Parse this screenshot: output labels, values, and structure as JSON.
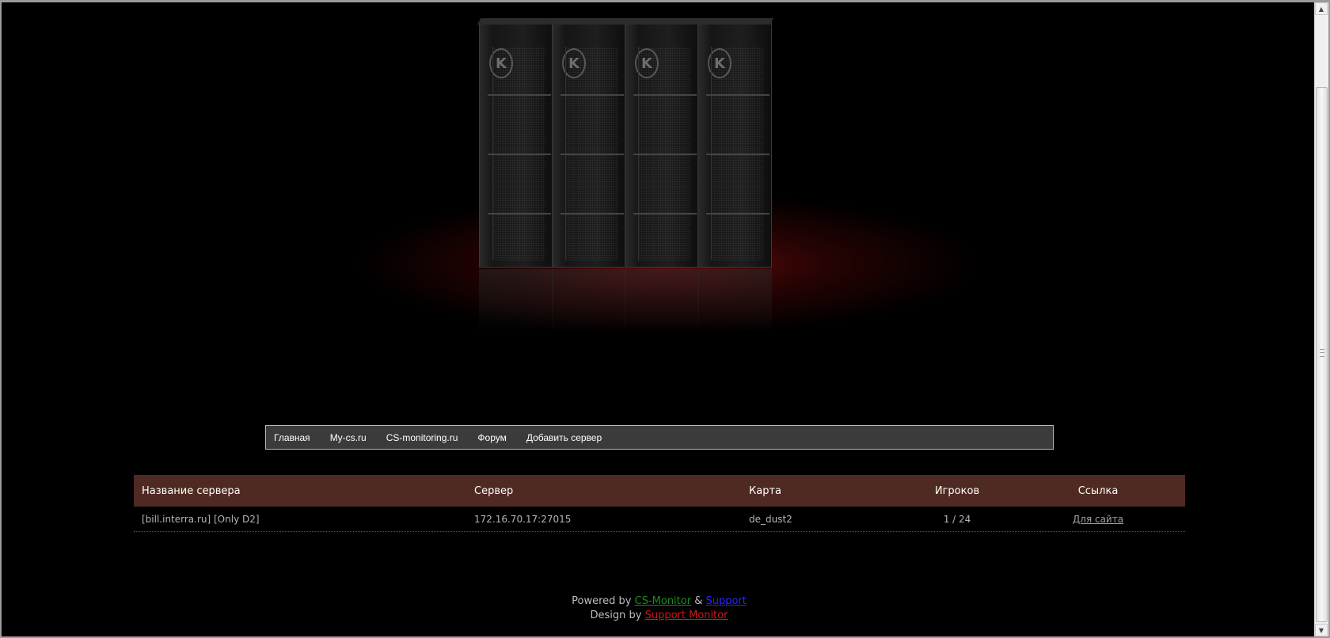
{
  "nav": {
    "items": [
      {
        "label": "Главная"
      },
      {
        "label": "My-cs.ru"
      },
      {
        "label": "CS-monitoring.ru"
      },
      {
        "label": "Форум"
      },
      {
        "label": "Добавить сервер"
      }
    ]
  },
  "table": {
    "headers": {
      "name": "Название сервера",
      "server": "Сервер",
      "map": "Карта",
      "players": "Игроков",
      "link": "Ссылка"
    },
    "rows": [
      {
        "name": "[bill.interra.ru] [Only D2]",
        "server": "172.16.70.17:27015",
        "map": "de_dust2",
        "players": "1 / 24",
        "link": "Для сайта"
      }
    ]
  },
  "footer": {
    "powered_prefix": "Powered by",
    "powered_link1": "CS-Monitor",
    "amp": "&",
    "powered_link2": "Support",
    "design_prefix": "Design by",
    "design_link": "Support Monitor"
  },
  "colors": {
    "background": "#000000",
    "nav_bg": "#3b3b3b",
    "table_header_bg": "#4f2a22",
    "link_green": "#1f8a1f",
    "link_blue": "#2727ff",
    "link_red": "#d01818"
  },
  "banner": {
    "icons": [
      "server-rack",
      "server-rack",
      "server-rack",
      "server-rack"
    ]
  }
}
